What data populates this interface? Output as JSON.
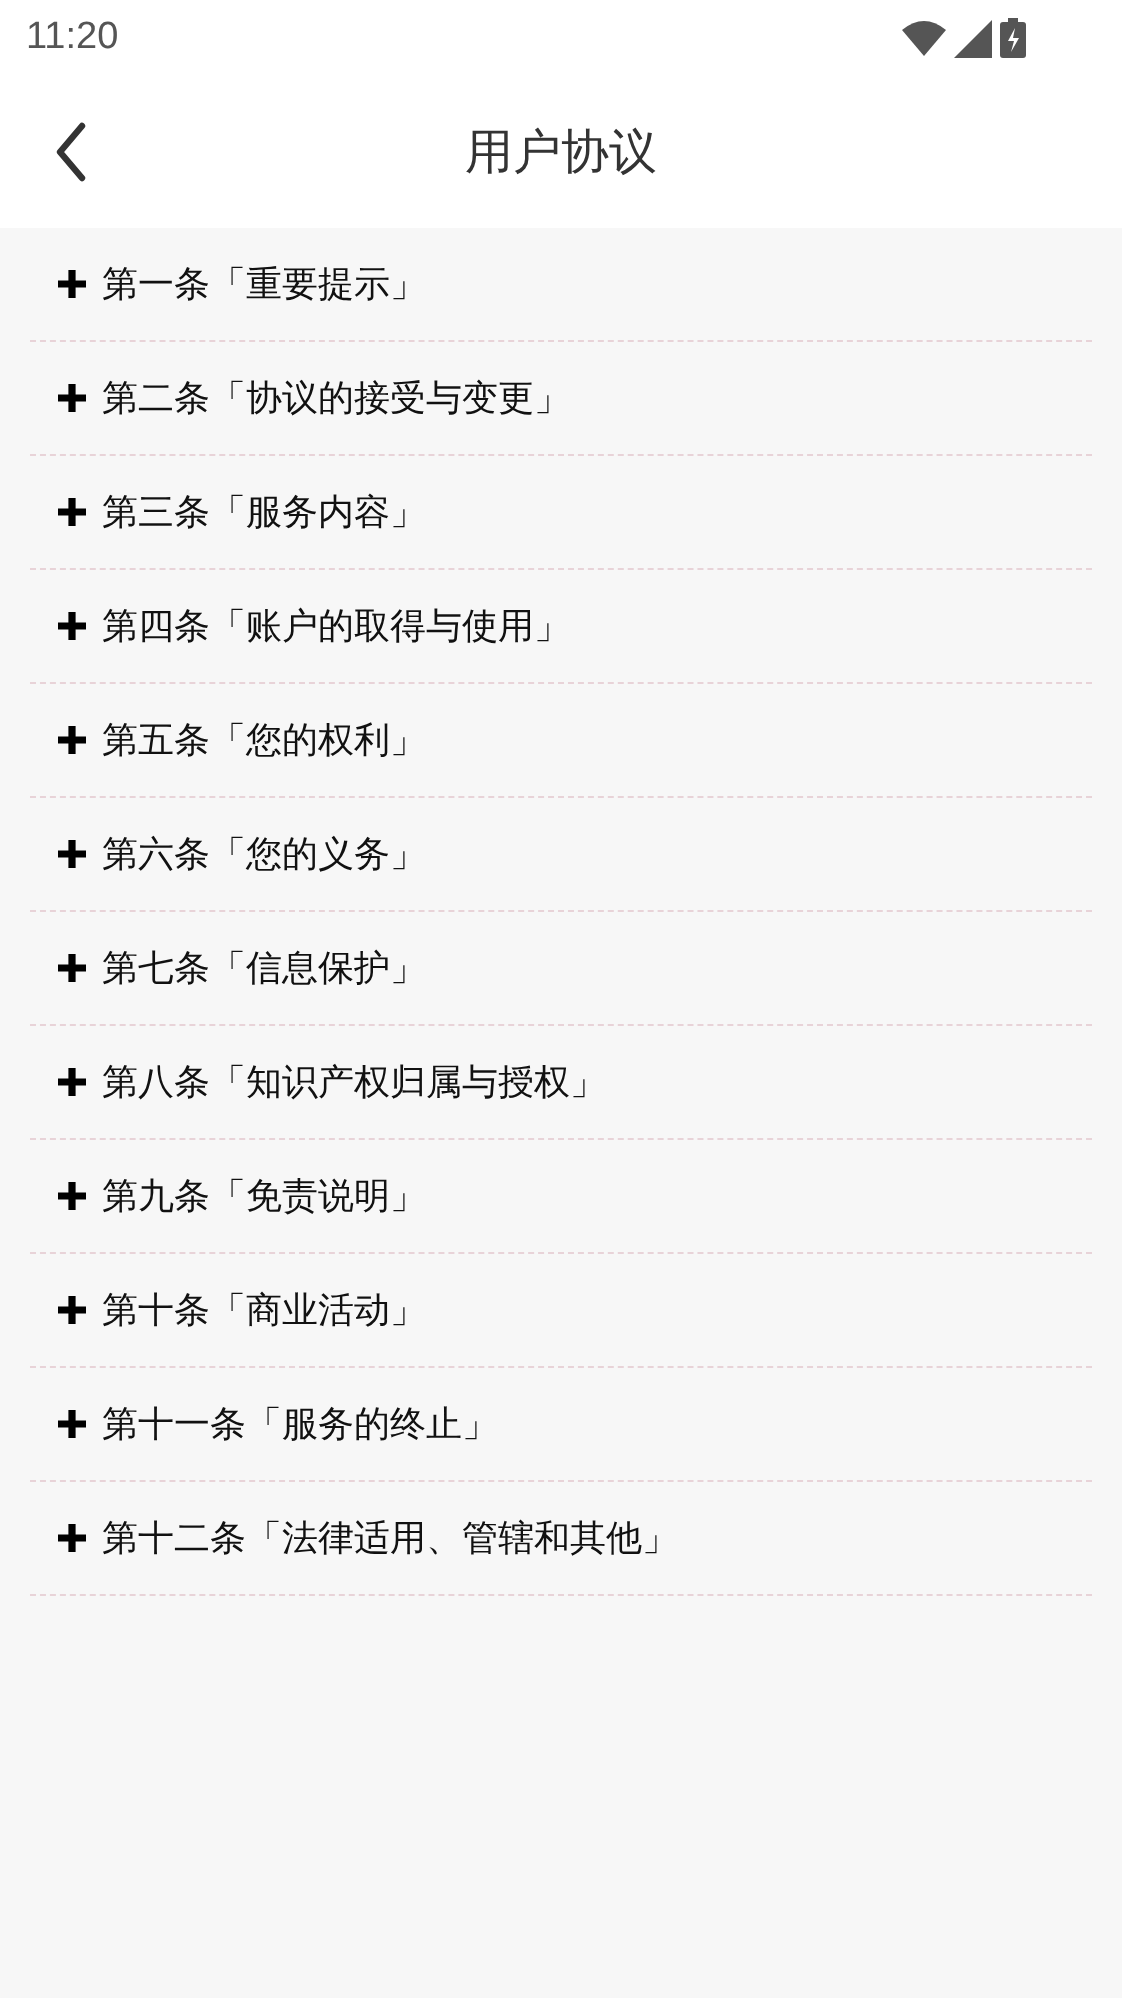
{
  "status_bar": {
    "time": "11:20"
  },
  "nav_bar": {
    "title": "用户协议"
  },
  "sections": [
    {
      "title": "第一条「重要提示」",
      "expanded": false
    },
    {
      "title": "第二条「协议的接受与变更」",
      "expanded": false
    },
    {
      "title": "第三条「服务内容」",
      "expanded": false
    },
    {
      "title": "第四条「账户的取得与使用」",
      "expanded": false
    },
    {
      "title": "第五条「您的权利」",
      "expanded": false
    },
    {
      "title": "第六条「您的义务」",
      "expanded": false
    },
    {
      "title": "第七条「信息保护」",
      "expanded": false
    },
    {
      "title": "第八条「知识产权归属与授权」",
      "expanded": false
    },
    {
      "title": "第九条「免责说明」",
      "expanded": false
    },
    {
      "title": "第十条「商业活动」",
      "expanded": false
    },
    {
      "title": "第十一条「服务的终止」",
      "expanded": false
    },
    {
      "title": "第十二条「法律适用、管辖和其他」",
      "expanded": false
    }
  ]
}
